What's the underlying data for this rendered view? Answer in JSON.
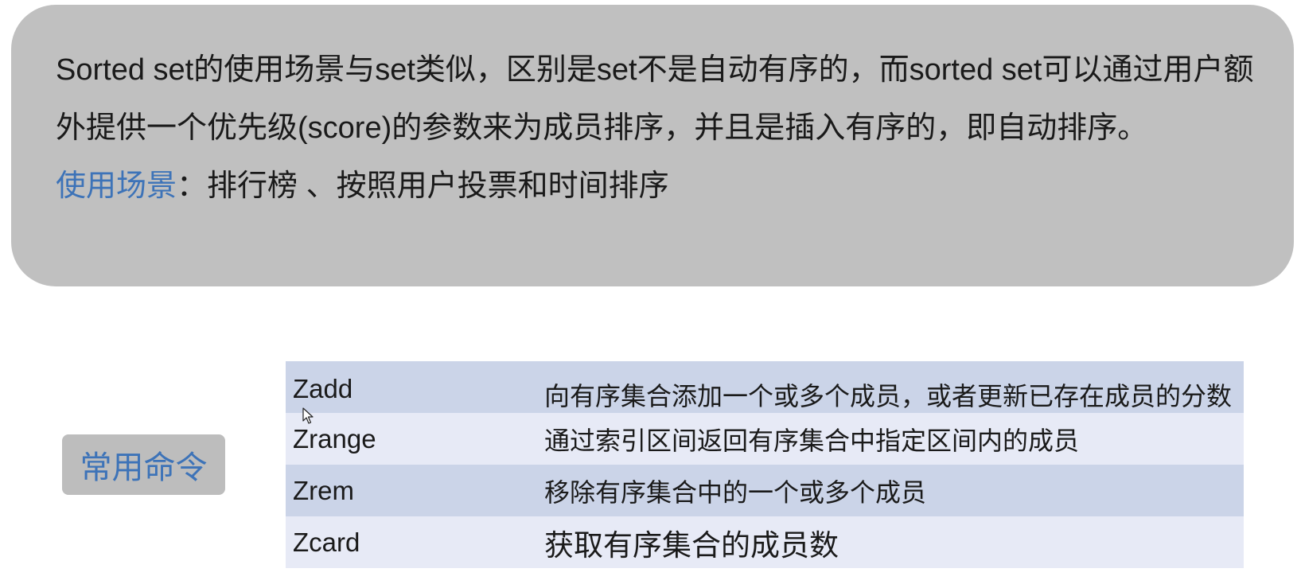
{
  "intro": {
    "text": "Sorted set的使用场景与set类似，区别是set不是自动有序的，而sorted set可以通过用户额外提供一个优先级(score)的参数来为成员排序，并且是插入有序的，即自动排序。",
    "usage_label": "使用场景",
    "usage_value": "：排行榜 、按照用户投票和时间排序"
  },
  "commands_label": "常用命令",
  "commands": [
    {
      "name": "Zadd",
      "desc": "向有序集合添加一个或多个成员，或者更新已存在成员的分数"
    },
    {
      "name": "Zrange",
      "desc": "通过索引区间返回有序集合中指定区间内的成员"
    },
    {
      "name": "Zrem",
      "desc": "移除有序集合中的一个或多个成员"
    },
    {
      "name": "Zcard",
      "desc": "获取有序集合的成员数"
    }
  ],
  "colors": {
    "accent_blue": "#3d73b8",
    "box_gray": "#c0c0c0",
    "row_dark": "#cbd4e8",
    "row_light": "#e7eaf6"
  },
  "icons": [
    "mouse-cursor-icon"
  ]
}
